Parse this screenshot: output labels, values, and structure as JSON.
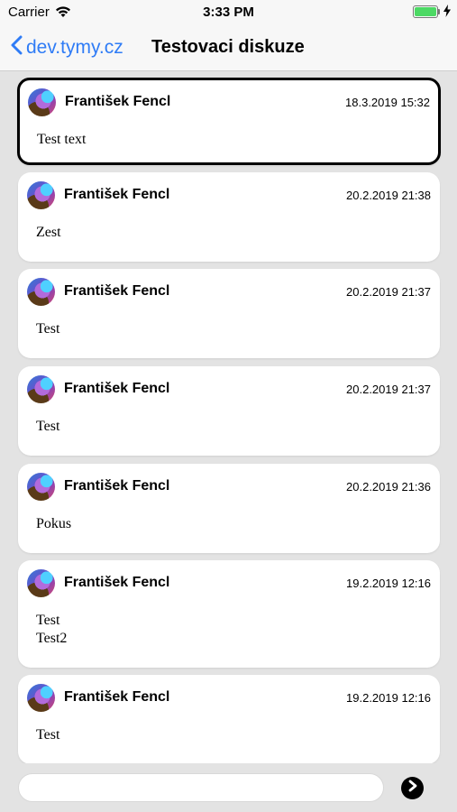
{
  "status_bar": {
    "carrier": "Carrier",
    "time": "3:33 PM"
  },
  "nav": {
    "back_label": "dev.tymy.cz",
    "title": "Testovaci diskuze"
  },
  "posts": [
    {
      "author": "František Fencl",
      "date": "18.3.2019 15:32",
      "text": "Test text"
    },
    {
      "author": "František Fencl",
      "date": "20.2.2019 21:38",
      "text": "Zest"
    },
    {
      "author": "František Fencl",
      "date": "20.2.2019 21:37",
      "text": "Test"
    },
    {
      "author": "František Fencl",
      "date": "20.2.2019 21:37",
      "text": "Test"
    },
    {
      "author": "František Fencl",
      "date": "20.2.2019 21:36",
      "text": "Pokus"
    },
    {
      "author": "František Fencl",
      "date": "19.2.2019 12:16",
      "text": "Test\nTest2"
    },
    {
      "author": "František Fencl",
      "date": "19.2.2019 12:16",
      "text": "Test"
    }
  ],
  "compose": {
    "value": "",
    "placeholder": ""
  },
  "colors": {
    "accent": "#2f7cf6",
    "battery": "#4cd964",
    "background": "#e3e3e3"
  }
}
